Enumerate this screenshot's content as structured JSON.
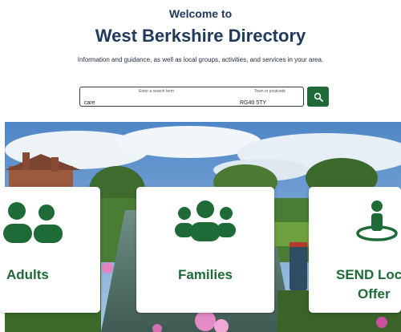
{
  "header": {
    "welcome": "Welcome to",
    "title": "West Berkshire Directory",
    "intro": "Information and guidance, as well as local groups, activities, and services in your area."
  },
  "search": {
    "term_label": "Enter a search term",
    "term_value": "care",
    "postcode_label": "Town or postcode",
    "postcode_value": "RG40 5TY",
    "button_icon": "search-icon"
  },
  "cards": {
    "adults": {
      "label": "Adults",
      "icon": "two-people-icon"
    },
    "families": {
      "label": "Families",
      "icon": "family-group-icon"
    },
    "send": {
      "label_line1": "SEND Loc",
      "label_line2": "Offer",
      "icon": "person-location-icon"
    }
  },
  "colors": {
    "brand_green": "#1e6b38",
    "heading_navy": "#203a5c"
  }
}
